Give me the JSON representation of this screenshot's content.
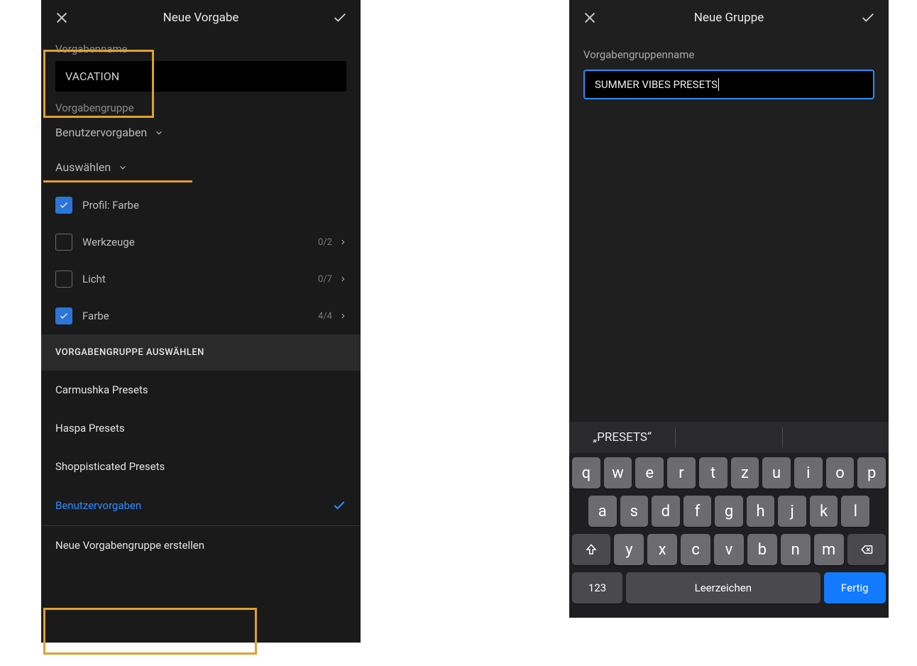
{
  "left": {
    "title": "Neue Vorgabe",
    "preset_name_label": "Vorgabenname",
    "preset_name_value": "VACATION",
    "preset_group_label": "Vorgabengruppe",
    "preset_group_value": "Benutzervorgaben",
    "select_label": "Auswählen",
    "options": [
      {
        "label": "Profil: Farbe",
        "checked": true,
        "count": "",
        "chevron": false
      },
      {
        "label": "Werkzeuge",
        "checked": false,
        "count": "0/2",
        "chevron": true
      },
      {
        "label": "Licht",
        "checked": false,
        "count": "0/7",
        "chevron": true
      },
      {
        "label": "Farbe",
        "checked": true,
        "count": "4/4",
        "chevron": true
      }
    ],
    "choose_group_header": "VORGABENGRUPPE AUSWÄHLEN",
    "presets": [
      {
        "label": "Carmushka Presets",
        "selected": false
      },
      {
        "label": "Haspa Presets",
        "selected": false
      },
      {
        "label": "Shoppisticated Presets",
        "selected": false
      },
      {
        "label": "Benutzervorgaben",
        "selected": true
      }
    ],
    "new_group_label": "Neue Vorgabengruppe erstellen"
  },
  "right": {
    "title": "Neue Gruppe",
    "group_name_label": "Vorgabengruppenname",
    "group_name_value": "SUMMER VIBES PRESETS",
    "suggestion": "„PRESETS“",
    "keyboard": {
      "row1": [
        "q",
        "w",
        "e",
        "r",
        "t",
        "z",
        "u",
        "i",
        "o",
        "p"
      ],
      "row2": [
        "a",
        "s",
        "d",
        "f",
        "g",
        "h",
        "j",
        "k",
        "l"
      ],
      "row3": [
        "y",
        "x",
        "c",
        "v",
        "b",
        "n",
        "m"
      ],
      "num_label": "123",
      "space_label": "Leerzeichen",
      "done_label": "Fertig"
    }
  }
}
